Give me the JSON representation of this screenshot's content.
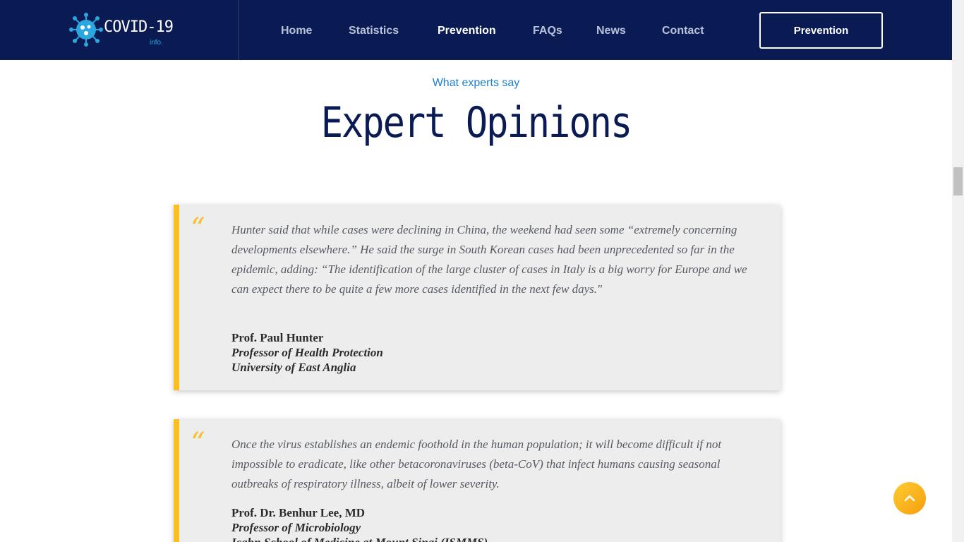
{
  "header": {
    "logo_text": "COVID-19",
    "logo_sub": "info.",
    "nav": [
      "Home",
      "Statistics",
      "Prevention",
      "FAQs",
      "News",
      "Contact"
    ],
    "active_nav": "Prevention",
    "cta_label": "Prevention"
  },
  "section": {
    "eyebrow": "What experts say",
    "title": "Expert Opinions"
  },
  "quotes": [
    {
      "mark": "“",
      "text": "Hunter said that while cases were declining in China, the weekend had seen some “extremely concerning developments elsewhere.” He said the surge in South Korean cases had been unprecedented so far in the epidemic, adding: “The identification of the large cluster of cases in Italy is a big worry for Europe and we can expect there to be quite a few more cases identified in the next few days.\"",
      "name": "Prof. Paul Hunter",
      "title": "Professor of Health Protection",
      "org": "University of East Anglia"
    },
    {
      "mark": "“",
      "text": "Once the virus establishes an endemic foothold in the human population; it will become difficult if not impossible to eradicate, like other betacoronaviruses (beta-CoV) that infect humans causing seasonal outbreaks of respiratory illness, albeit of lower severity.",
      "name": "Prof. Dr. Benhur Lee, MD",
      "title": "Professor of Microbiology",
      "org": "Icahn School of Medicine at Mount Sinai (ISMMS)"
    }
  ],
  "colors": {
    "navy": "#0a1b54",
    "accent": "#fbbf24",
    "link_blue": "#1d7fd0"
  },
  "icons": {
    "logo": "virus-icon",
    "back_to_top": "chevron-up-icon"
  }
}
